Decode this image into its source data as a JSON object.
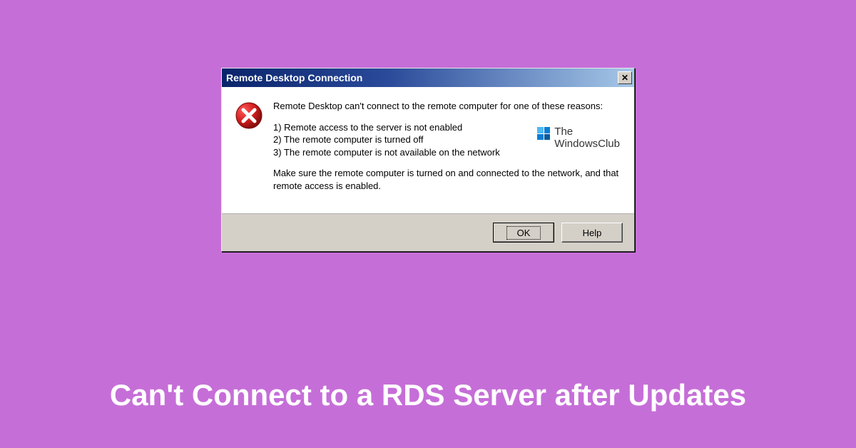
{
  "dialog": {
    "title": "Remote Desktop Connection",
    "close_label": "✕",
    "message_intro": "Remote Desktop can't connect to the remote computer for one of these reasons:",
    "reason1": "1) Remote access to the server is not enabled",
    "reason2": "2) The remote computer is turned off",
    "reason3": "3) The remote computer is not available on the network",
    "message_footer": "Make sure the remote computer is turned on and connected to the network, and that remote access is enabled.",
    "ok_label": "OK",
    "help_label": "Help"
  },
  "watermark": {
    "line1": "The",
    "line2": "WindowsClub"
  },
  "caption": "Can't Connect to a RDS Server after Updates",
  "colors": {
    "background": "#c66ed8",
    "titlebar_start": "#0a246a",
    "titlebar_end": "#a6c8e8",
    "dialog_face": "#d4d0c8",
    "error_icon": "#c41e1e"
  }
}
